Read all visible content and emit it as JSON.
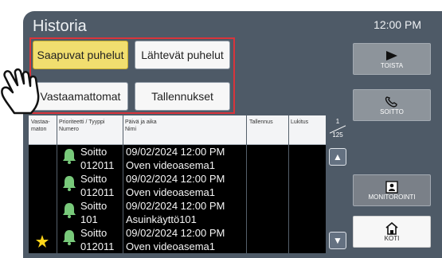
{
  "screen": {
    "title": "Historia",
    "clock": "12:00 PM"
  },
  "tabs": [
    {
      "label": "Saapuvat puhelut",
      "active": true
    },
    {
      "label": "Lähtevät puhelut",
      "active": false
    },
    {
      "label": "Vastaamattomat",
      "active": false
    },
    {
      "label": "Tallennukset",
      "active": false
    }
  ],
  "table": {
    "headers": {
      "missed": "Vastaa-\nmaton",
      "priority": "Prioriteetti / Tyyppi\nNumero",
      "datetime": "Päivä ja aika\nNimi",
      "recording": "Tallennus",
      "lock": "Lukitus"
    },
    "rows": [
      {
        "type": "Soitto",
        "number": "012011",
        "date": "09/02/2024 12:00 PM",
        "name": "Oven videoasema1",
        "missed": false
      },
      {
        "type": "Soitto",
        "number": "012011",
        "date": "09/02/2024 12:00 PM",
        "name": "Oven videoasema1",
        "missed": false
      },
      {
        "type": "Soitto",
        "number": "101",
        "date": "09/02/2024 12:00 PM",
        "name": "Asuinkäyttö101",
        "missed": false
      },
      {
        "type": "Soitto",
        "number": "012011",
        "date": "09/02/2024 12:00 PM",
        "name": "Oven videoasema1",
        "missed": true
      }
    ]
  },
  "pager": {
    "page": "1",
    "total": "125"
  },
  "side_buttons": {
    "play": "TOISTA",
    "call": "SOITTO",
    "monitor": "MONITOROINTI",
    "home": "KOTI"
  },
  "colors": {
    "active_tab": "#f1de6f",
    "highlight_frame": "#d9343b",
    "bell": "#78c97a",
    "star": "#ffd51a"
  }
}
